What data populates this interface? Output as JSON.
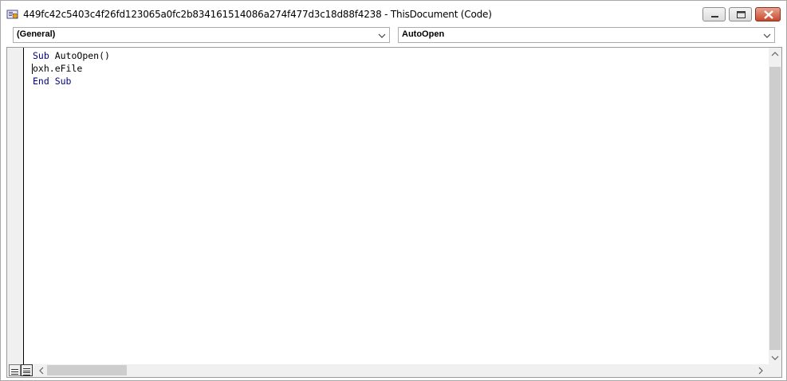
{
  "window": {
    "title": "449fc42c5403c4f26fd123065a0fc2b834161514086a274f477d3c18d88f4238 - ThisDocument (Code)"
  },
  "toolbar": {
    "object_combo_value": "(General)",
    "procedure_combo_value": "AutoOpen"
  },
  "code": {
    "lines": [
      [
        {
          "text": "Sub ",
          "kw": true
        },
        {
          "text": "AutoOpen()",
          "kw": false
        }
      ],
      [
        {
          "text": "oxh.eFile",
          "kw": false
        }
      ],
      [
        {
          "text": "End Sub",
          "kw": true
        }
      ]
    ]
  },
  "colors": {
    "keyword": "#00007f",
    "text": "#000000",
    "close_button": "#c9482c"
  },
  "icons": [
    "app-icon",
    "minimize-icon",
    "maximize-icon",
    "close-icon",
    "chevron-down-icon",
    "procedure-view-icon",
    "full-module-view-icon",
    "scroll-left-icon",
    "scroll-right-icon",
    "scroll-up-icon",
    "scroll-down-icon"
  ]
}
